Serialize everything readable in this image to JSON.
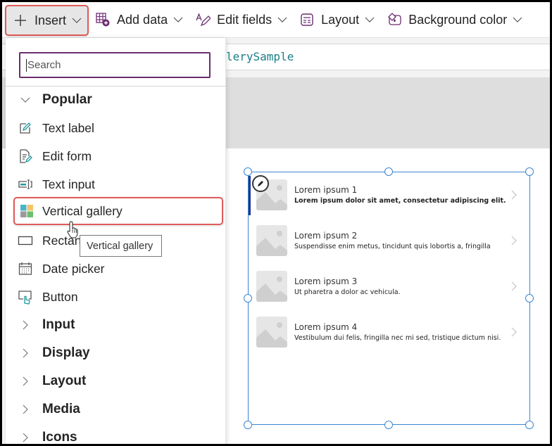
{
  "toolbar": {
    "buttons": [
      {
        "label": "Insert",
        "icon": "plus-icon"
      },
      {
        "label": "Add data",
        "icon": "table-add-icon"
      },
      {
        "label": "Edit fields",
        "icon": "edit-fields-icon"
      },
      {
        "label": "Layout",
        "icon": "layout-icon"
      },
      {
        "label": "Background color",
        "icon": "paint-bucket-icon"
      }
    ]
  },
  "formula_bar": {
    "visible_text": "lerySample"
  },
  "insert_menu": {
    "search_placeholder": "Search",
    "sections": [
      {
        "label": "Popular",
        "expanded": true
      },
      {
        "label": "Input",
        "expanded": false
      },
      {
        "label": "Display",
        "expanded": false
      },
      {
        "label": "Layout",
        "expanded": false
      },
      {
        "label": "Media",
        "expanded": false
      },
      {
        "label": "Icons",
        "expanded": false
      }
    ],
    "popular_items": [
      {
        "label": "Text label",
        "icon": "text-label-icon"
      },
      {
        "label": "Edit form",
        "icon": "edit-form-icon"
      },
      {
        "label": "Text input",
        "icon": "text-input-icon"
      },
      {
        "label": "Vertical gallery",
        "icon": "vertical-gallery-icon",
        "highlighted": true
      },
      {
        "label": "Rectangle",
        "icon": "rectangle-icon"
      },
      {
        "label": "Date picker",
        "icon": "date-picker-icon"
      },
      {
        "label": "Button",
        "icon": "button-icon"
      }
    ],
    "tooltip": "Vertical gallery"
  },
  "gallery": {
    "items": [
      {
        "title": "Lorem ipsum 1",
        "subtitle": "Lorem ipsum dolor sit amet, consectetur adipiscing elit.",
        "selected": true
      },
      {
        "title": "Lorem ipsum 2",
        "subtitle": "Suspendisse enim metus, tincidunt quis lobortis a, fringilla"
      },
      {
        "title": "Lorem ipsum 3",
        "subtitle": "Ut pharetra a dolor ac vehicula."
      },
      {
        "title": "Lorem ipsum 4",
        "subtitle": "Vestibulum dui felis, fringilla nec mi sed, tristique dictum nisi."
      }
    ]
  },
  "colors": {
    "accent_purple": "#6b2d6f",
    "highlight_red": "#e05a5a",
    "selection_blue": "#3b86d1",
    "formula_teal": "#1b7f86"
  }
}
